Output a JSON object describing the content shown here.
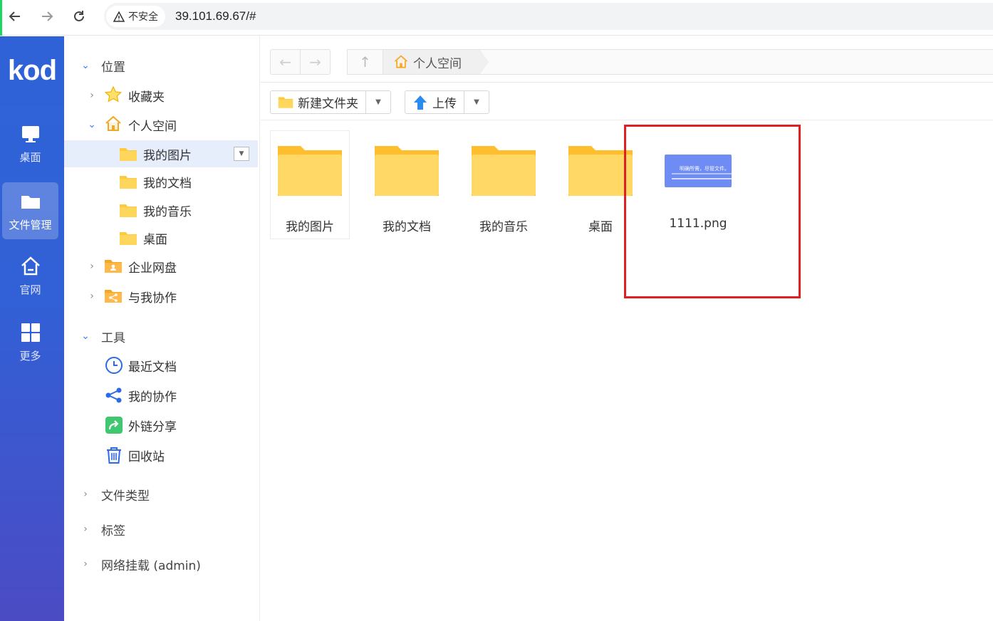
{
  "browser": {
    "security_label": "不安全",
    "url": "39.101.69.67/#"
  },
  "app": {
    "logo_text": "kod",
    "rail": [
      {
        "label": "桌面",
        "icon": "monitor-icon"
      },
      {
        "label": "文件管理",
        "icon": "folder-icon",
        "active": true
      },
      {
        "label": "官网",
        "icon": "home-icon"
      },
      {
        "label": "更多",
        "icon": "grid-icon"
      }
    ]
  },
  "tree": {
    "location_section": "位置",
    "favorites": "收藏夹",
    "personal_space": "个人空间",
    "children": [
      "我的图片",
      "我的文档",
      "我的音乐",
      "桌面"
    ],
    "enterprise_disk": "企业网盘",
    "shared_with_me": "与我协作",
    "tools_section": "工具",
    "tools": [
      "最近文档",
      "我的协作",
      "外链分享",
      "回收站"
    ],
    "file_types": "文件类型",
    "tags": "标签",
    "network_mount": "网络挂载 (admin)"
  },
  "pathbar": {
    "crumb": "个人空间"
  },
  "toolbar": {
    "new_folder": "新建文件夹",
    "upload": "上传"
  },
  "files": [
    {
      "name": "我的图片",
      "type": "folder"
    },
    {
      "name": "我的文档",
      "type": "folder"
    },
    {
      "name": "我的音乐",
      "type": "folder"
    },
    {
      "name": "桌面",
      "type": "folder"
    },
    {
      "name": "1111.png",
      "type": "image"
    }
  ],
  "png_thumb_caption": "明确所需，尽管文件。",
  "colors": {
    "rail_blue": "#2f64d8",
    "folder_yellow": "#ffc93c",
    "highlight_red": "#e02020",
    "selected_bg": "#e6eefc"
  }
}
